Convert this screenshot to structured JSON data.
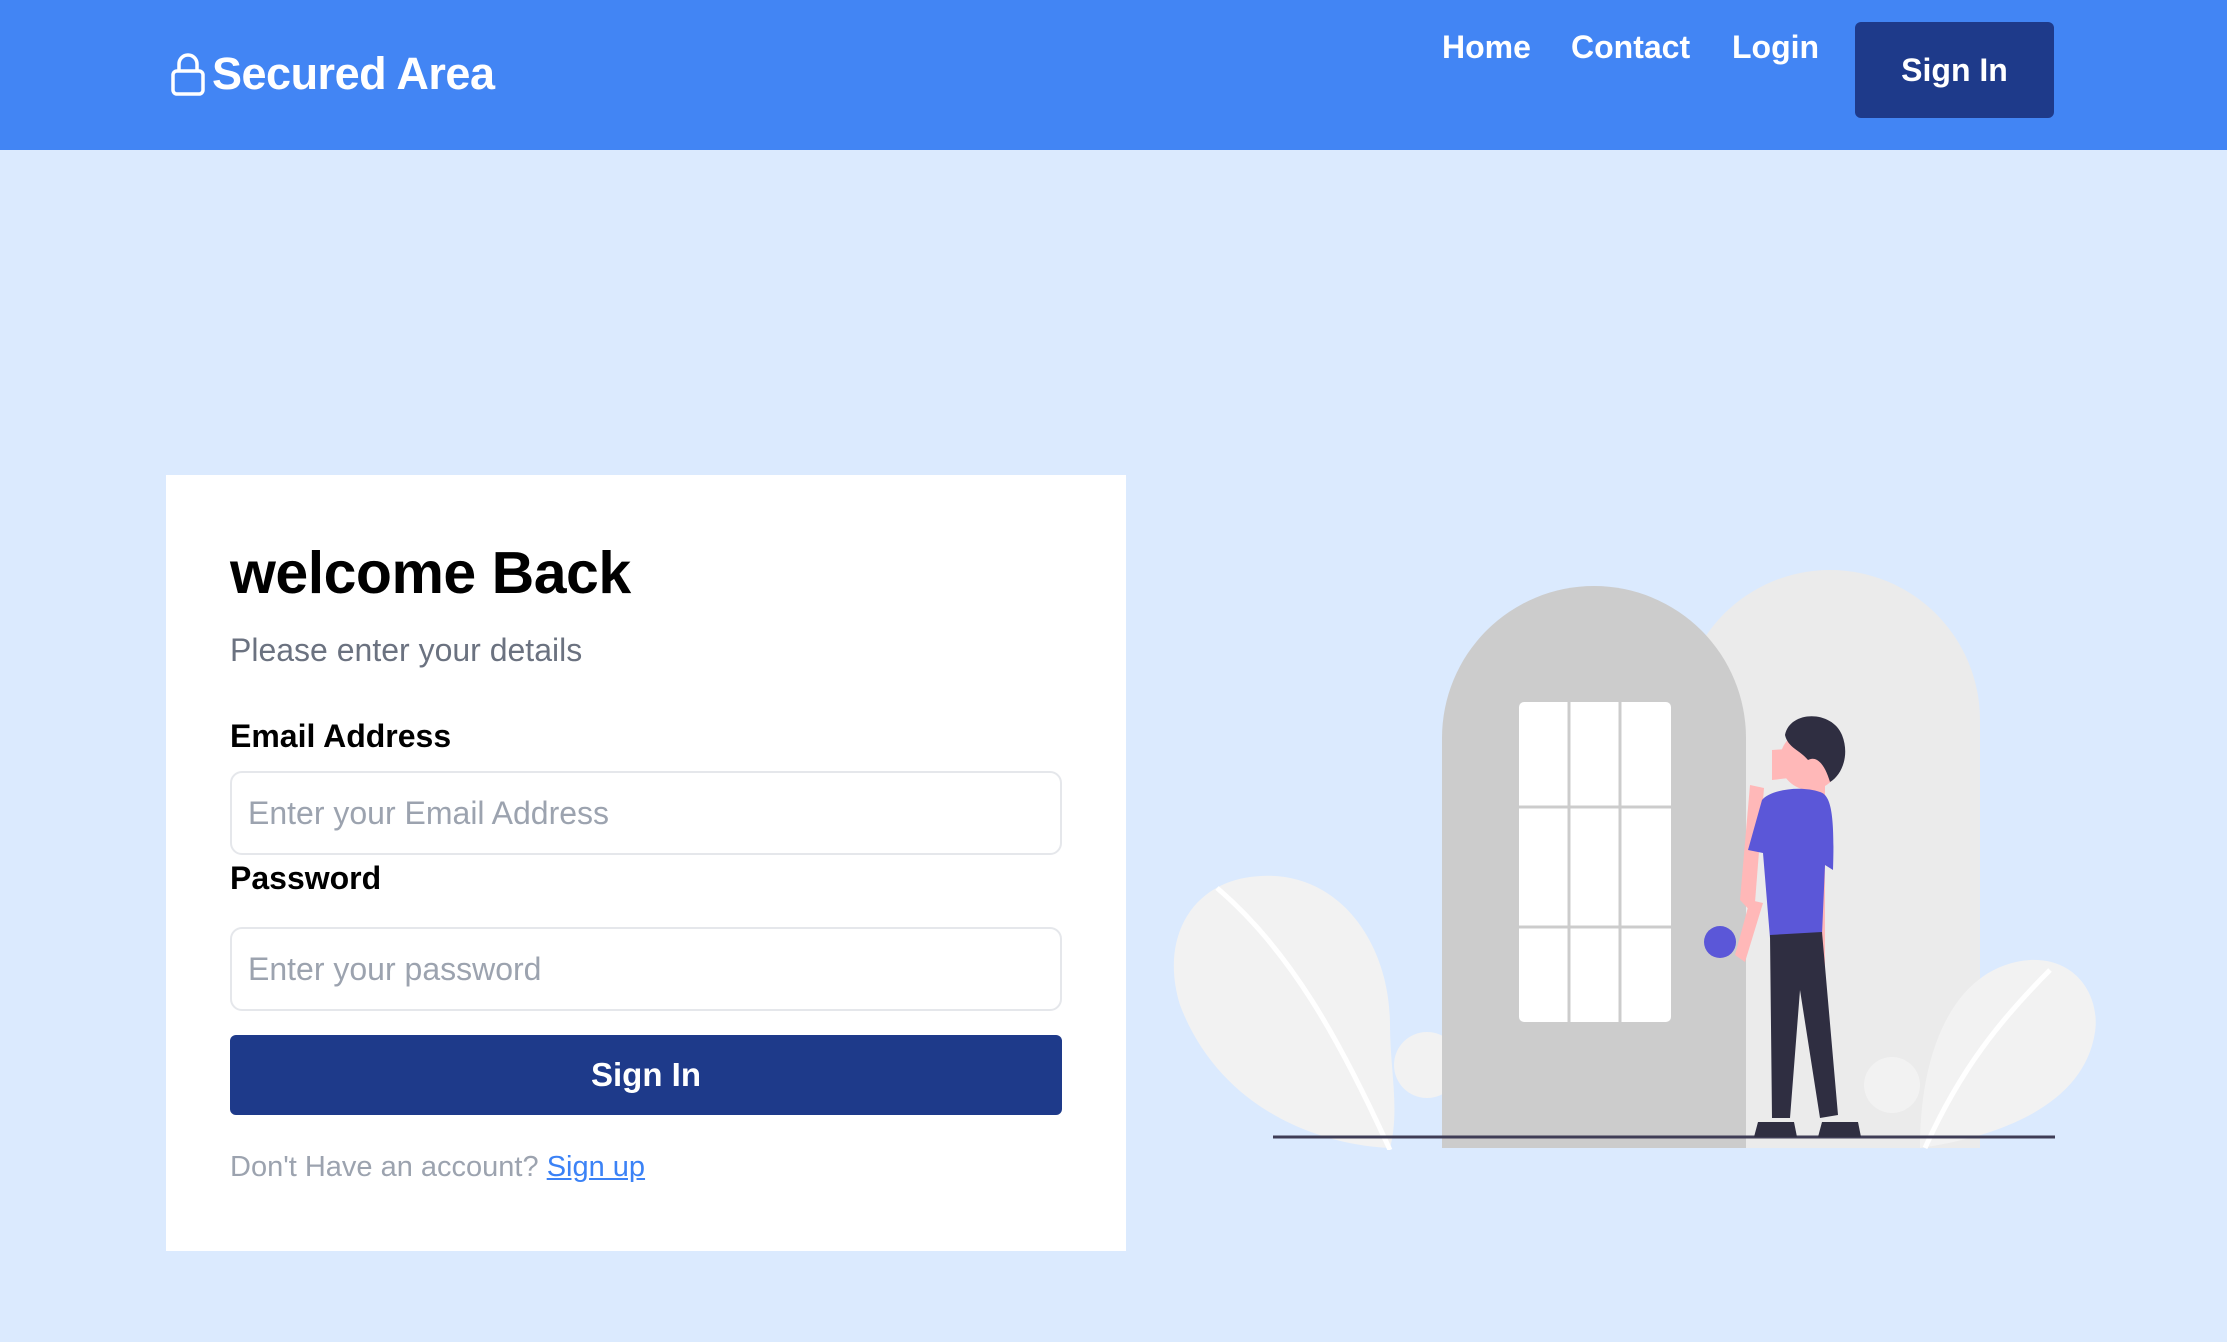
{
  "header": {
    "brand": {
      "icon": "lock-icon",
      "title": "Secured Area"
    },
    "nav": [
      {
        "label": "Home"
      },
      {
        "label": "Contact"
      },
      {
        "label": "Login"
      }
    ],
    "signin_label": "Sign In"
  },
  "login": {
    "title": "welcome Back",
    "subtitle": "Please enter your details",
    "email": {
      "label": "Email Address",
      "placeholder": "Enter your Email Address",
      "value": ""
    },
    "password": {
      "label": "Password",
      "placeholder": "Enter your password",
      "value": ""
    },
    "submit_label": "Sign In",
    "footer": {
      "prompt": "Don't Have an account?",
      "link": "Sign up"
    }
  },
  "illustration": {
    "icon": "person-at-door-illustration"
  },
  "colors": {
    "navbar": "#4285f4",
    "primary_button": "#1e3a8a",
    "page_background": "#dbeafe",
    "link": "#3b82f6",
    "person_shirt": "#5b57d8"
  }
}
